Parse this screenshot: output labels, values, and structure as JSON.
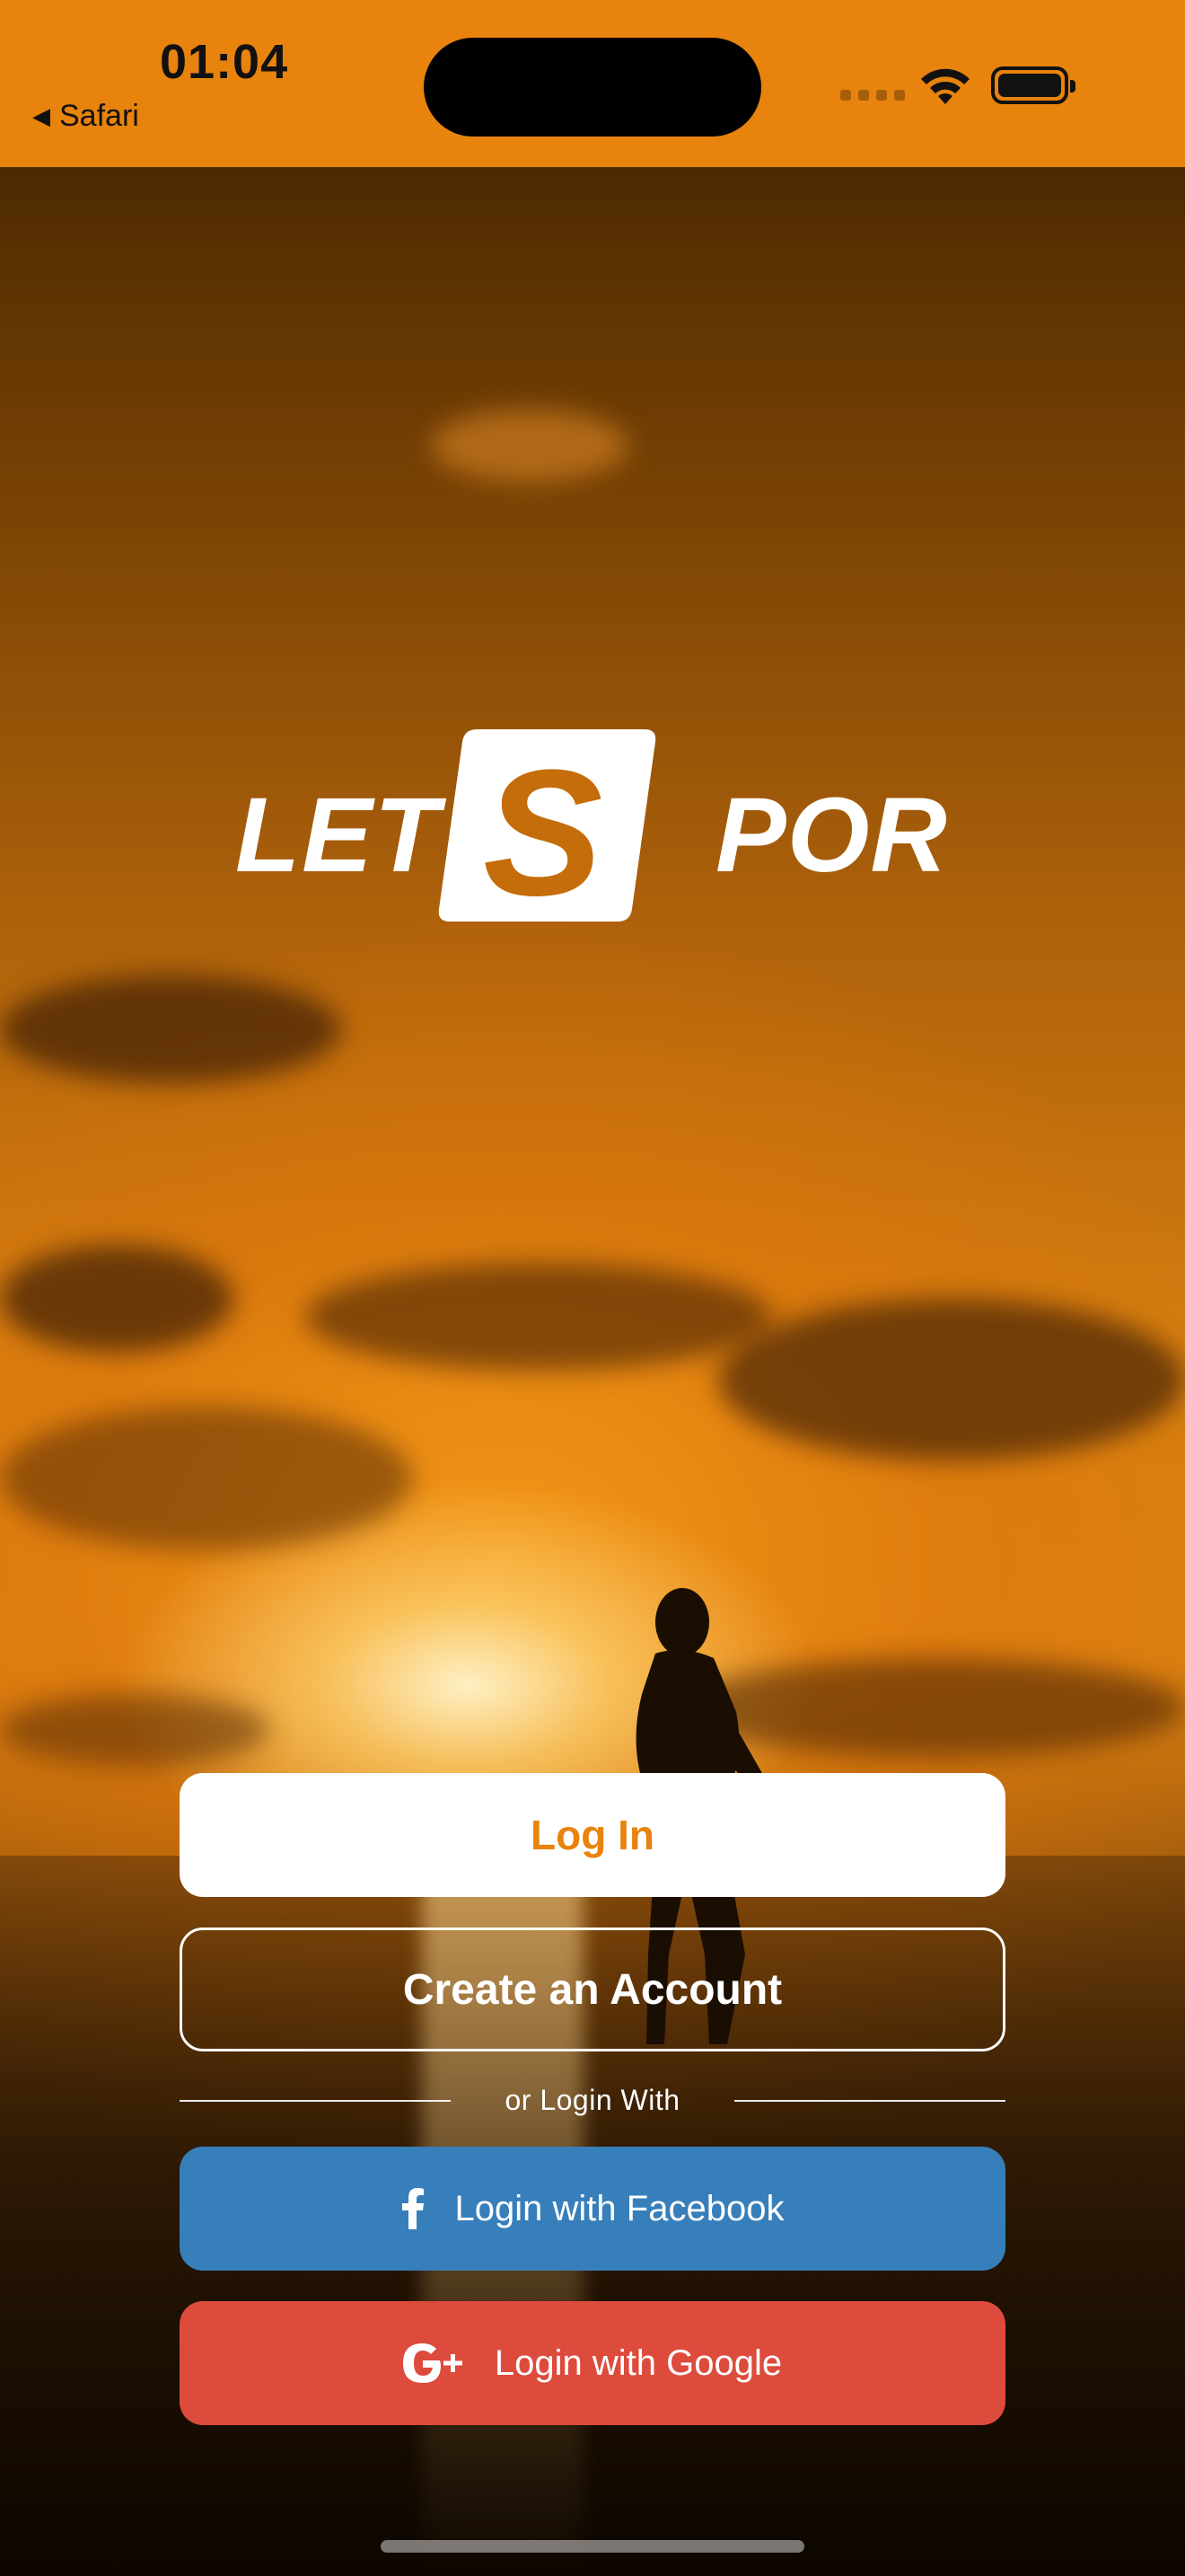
{
  "status_bar": {
    "time": "01:04",
    "back_app": "Safari",
    "back_icon": "back-triangle-icon",
    "wifi_icon": "wifi-icon",
    "battery_icon": "battery-icon",
    "signal_icon": "cellular-signal-icon",
    "background_color": "#e8830e"
  },
  "brand": {
    "logo_text": "LET'SPORT",
    "logo_color": "#ffffff"
  },
  "actions": {
    "login_label": "Log In",
    "create_account_label": "Create an Account",
    "divider_text": "or Login With",
    "facebook_label": "Login with Facebook",
    "facebook_icon": "facebook-icon",
    "google_label": "Login with Google",
    "google_icon": "google-plus-icon"
  },
  "colors": {
    "accent": "#e8830e",
    "facebook": "#377fbb",
    "google": "#dd4b3c"
  }
}
